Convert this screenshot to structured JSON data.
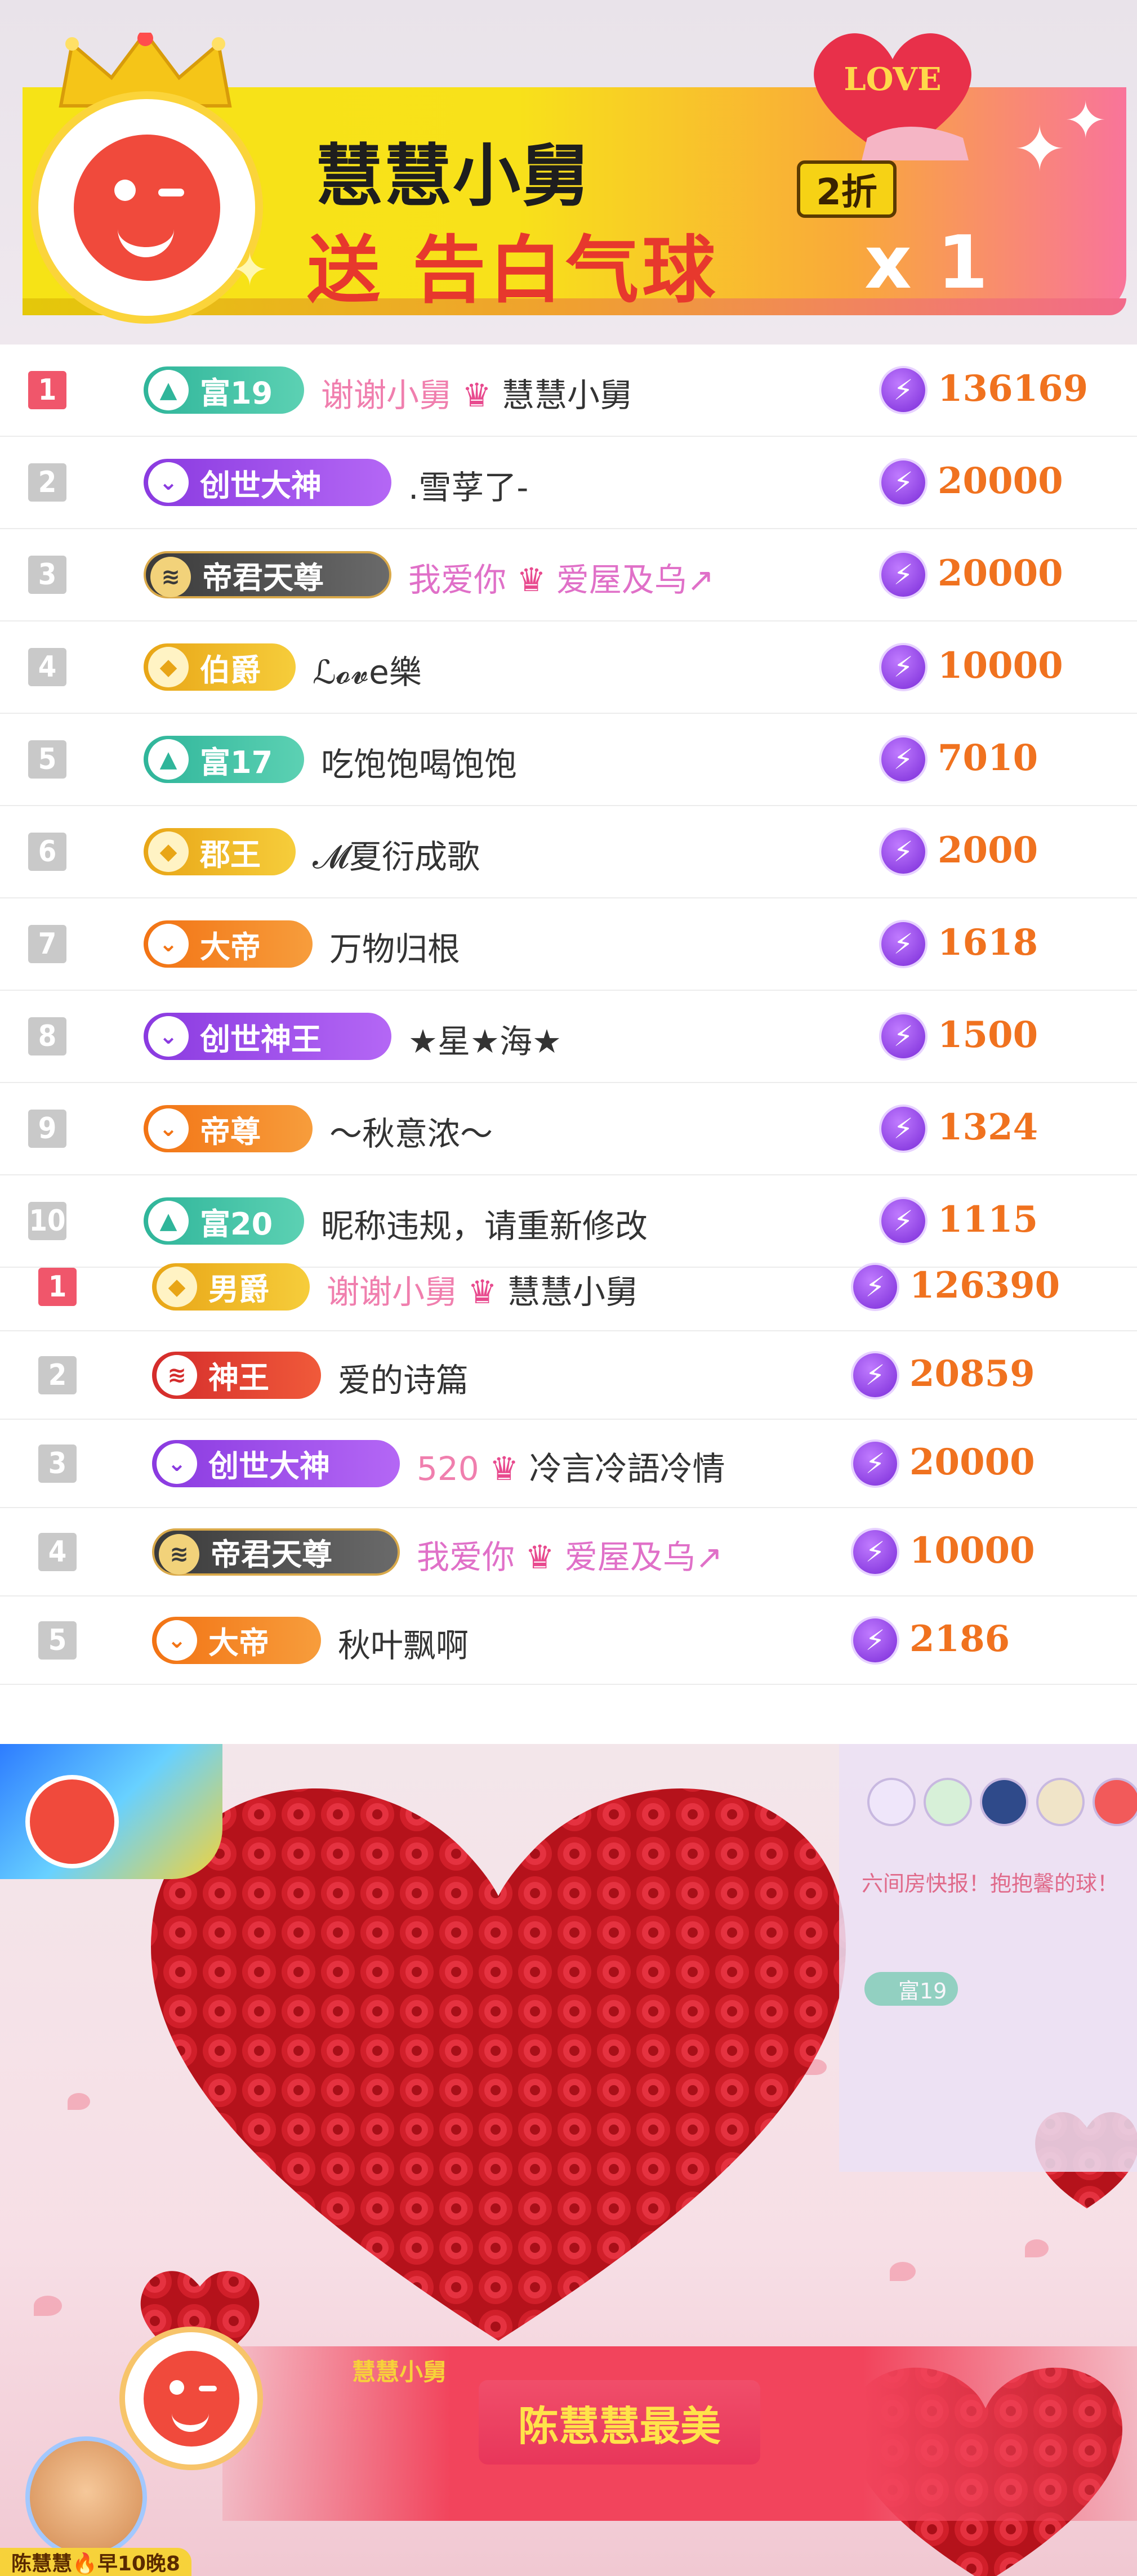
{
  "banner": {
    "sender_name": "慧慧小舅",
    "gift_text": "送 告白气球",
    "gift_image_text": "LOVE",
    "discount": "2折",
    "count": "x 1",
    "crown_icon": "crown-icon",
    "avatar_icon": "wink-face-icon"
  },
  "list1": [
    {
      "rank": "1",
      "badge": "富19",
      "badge_style": "rich",
      "name": "谢谢小舅",
      "name_suffix": "慧慧小舅",
      "score": "136169"
    },
    {
      "rank": "2",
      "badge": "创世大神",
      "badge_style": "purple",
      "name": ".雪莩了-",
      "name_suffix": "",
      "score": "20000"
    },
    {
      "rank": "3",
      "badge": "帝君天尊",
      "badge_style": "dark",
      "name": "我爱你",
      "name_suffix": "爱屋及乌↗",
      "score": "20000"
    },
    {
      "rank": "4",
      "badge": "伯爵",
      "badge_style": "gold",
      "name": "ℒ𝓸𝓿e樂",
      "name_suffix": "",
      "score": "10000"
    },
    {
      "rank": "5",
      "badge": "富17",
      "badge_style": "rich",
      "name": "吃饱饱喝饱饱",
      "name_suffix": "",
      "score": "7010"
    },
    {
      "rank": "6",
      "badge": "郡王",
      "badge_style": "gold",
      "name": "𝓜夏衍成歌",
      "name_suffix": "",
      "score": "2000"
    },
    {
      "rank": "7",
      "badge": "大帝",
      "badge_style": "orange",
      "name": "万物归根",
      "name_suffix": "",
      "score": "1618"
    },
    {
      "rank": "8",
      "badge": "创世神王",
      "badge_style": "purple",
      "name": "★星★海★",
      "name_suffix": "",
      "score": "1500"
    },
    {
      "rank": "9",
      "badge": "帝尊",
      "badge_style": "orange",
      "name": "～秋意浓～",
      "name_suffix": "",
      "score": "1324"
    },
    {
      "rank": "10",
      "badge": "富20",
      "badge_style": "rich",
      "name": "昵称违规，请重新修改",
      "name_suffix": "",
      "score": "1115"
    }
  ],
  "list2": [
    {
      "rank": "1",
      "badge": "男爵",
      "badge_style": "gold",
      "name": "谢谢小舅",
      "name_suffix": "慧慧小舅",
      "score": "126390"
    },
    {
      "rank": "2",
      "badge": "神王",
      "badge_style": "red",
      "name": "爱的诗篇",
      "name_suffix": "",
      "score": "20859"
    },
    {
      "rank": "3",
      "badge": "创世大神",
      "badge_style": "purple",
      "name": "520",
      "name_suffix": "冷言冷語冷情",
      "score": "20000"
    },
    {
      "rank": "4",
      "badge": "帝君天尊",
      "badge_style": "dark",
      "name": "我爱你",
      "name_suffix": "爱屋及乌↗",
      "score": "10000"
    },
    {
      "rank": "5",
      "badge": "大帝",
      "badge_style": "orange",
      "name": "秋叶飘啊",
      "name_suffix": "",
      "score": "2186"
    }
  ],
  "stream": {
    "news_text": "六间房快报！抱抱馨的球！",
    "mini_badge": "富19",
    "gift_sender": "慧慧小舅",
    "gift_message": "陈慧慧最美",
    "host_tag": "陈慧慧🔥早10晚8",
    "heart_icon": "rose-heart-icon"
  },
  "colors": {
    "score": "#f0721f",
    "rank_first": "#f0566b",
    "rank_other": "#c9c9c9",
    "accent_pink": "#f07fae"
  }
}
